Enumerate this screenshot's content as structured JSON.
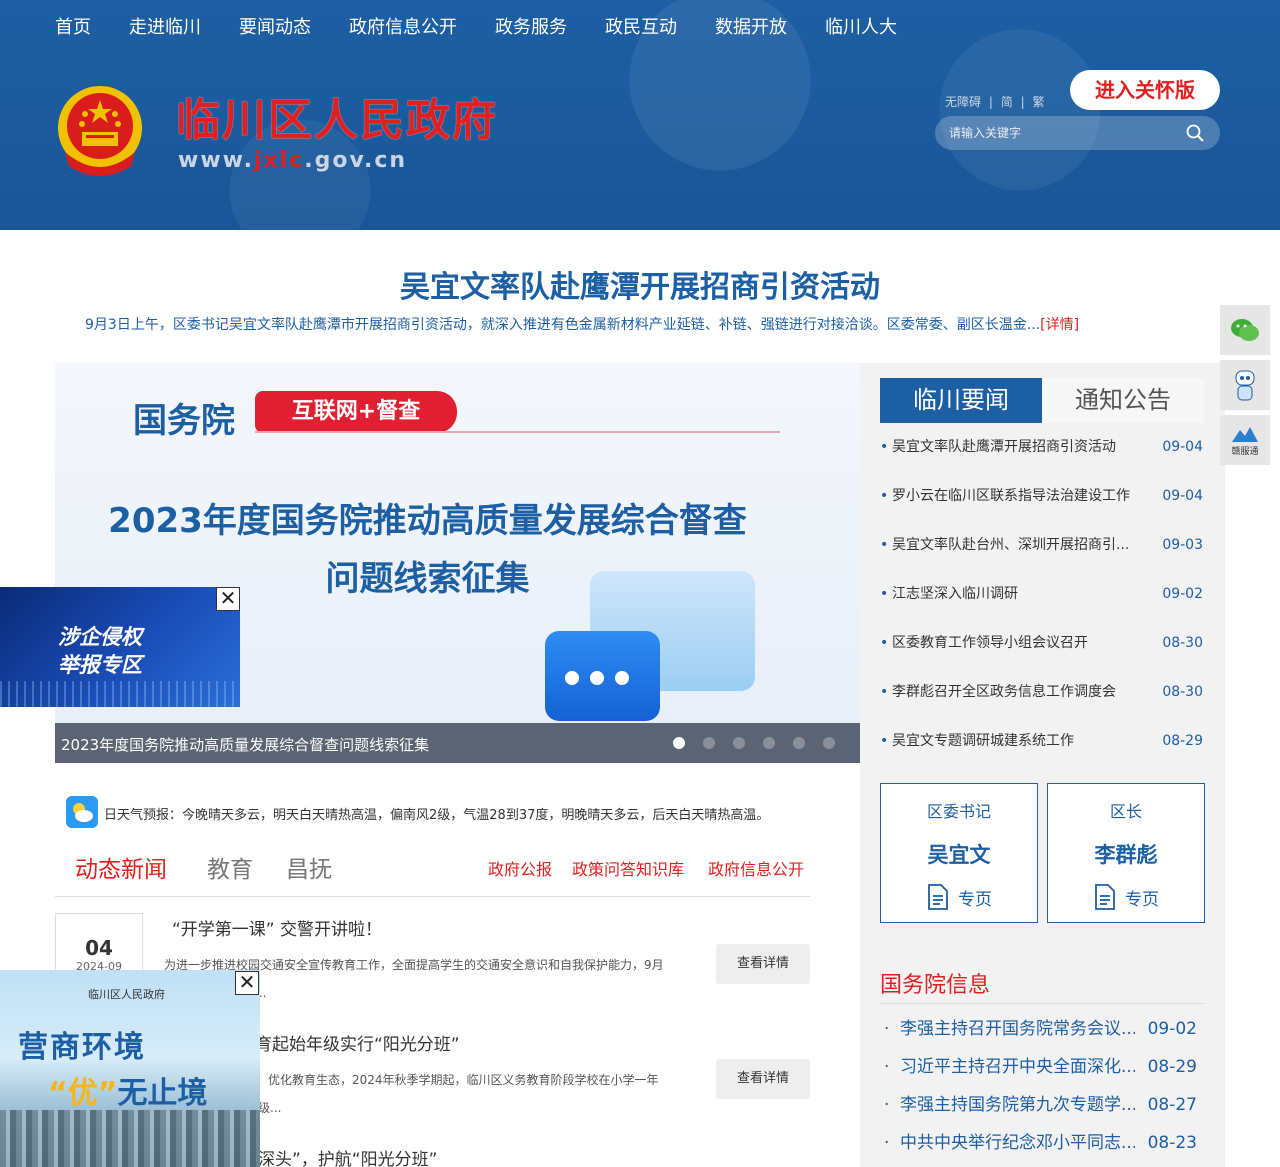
{
  "nav": [
    "首页",
    "走进临川",
    "要闻动态",
    "政府信息公开",
    "政务服务",
    "政民互动",
    "数据开放",
    "临川人大"
  ],
  "site": {
    "title": "临川区人民政府",
    "url_prefix": "www.",
    "url_highlight": "jxlc",
    "url_suffix": ".gov.cn"
  },
  "tools": {
    "accessible": "无障碍",
    "simplified": "简",
    "traditional": "繁",
    "sep": "|"
  },
  "care_mode": "进入关怀版",
  "search": {
    "placeholder": "请输入关键字"
  },
  "headline": {
    "title": "吴宜文率队赴鹰潭开展招商引资活动",
    "summary": "9月3日上午，区委书记吴宜文率队赴鹰潭市开展招商引资活动，就深入推进有色金属新材料产业延链、补链、强链进行对接洽谈。区委常委、副区长温金...",
    "more": "[详情]"
  },
  "carousel": {
    "logo": "国务院",
    "tag": "互联网+督查",
    "title_line1": "2023年度国务院推动高质量发展综合督查",
    "title_line2": "问题线索征集",
    "caption": "2023年度国务院推动高质量发展综合督查问题线索征集",
    "slide_count": 6,
    "active_slide": 1
  },
  "tabs": {
    "active": "临川要闻",
    "inactive": "通知公告"
  },
  "news": [
    {
      "title": "吴宜文率队赴鹰潭开展招商引资活动",
      "date": "09-04"
    },
    {
      "title": "罗小云在临川区联系指导法治建设工作",
      "date": "09-04"
    },
    {
      "title": "吴宜文率队赴台州、深圳开展招商引...",
      "date": "09-03"
    },
    {
      "title": "江志坚深入临川调研",
      "date": "09-02"
    },
    {
      "title": "区委教育工作领导小组会议召开",
      "date": "08-30"
    },
    {
      "title": "李群彪召开全区政务信息工作调度会",
      "date": "08-30"
    },
    {
      "title": "吴宜文专题调研城建系统工作",
      "date": "08-29"
    }
  ],
  "leaders": [
    {
      "role": "区委书记",
      "name": "吴宜文",
      "link": "专页"
    },
    {
      "role": "区长",
      "name": "李群彪",
      "link": "专页"
    }
  ],
  "state_council": {
    "title": "国务院信息",
    "items": [
      {
        "title": "李强主持召开国务院常务会议...",
        "date": "09-02"
      },
      {
        "title": "习近平主持召开中央全面深化...",
        "date": "08-29"
      },
      {
        "title": "李强主持国务院第九次专题学...",
        "date": "08-27"
      },
      {
        "title": "中共中央举行纪念邓小平同志...",
        "date": "08-23"
      }
    ]
  },
  "side_float": {
    "ganfutong": "赣服通"
  },
  "weather": "日天气预报：今晚晴天多云，明天白天晴热高温，偏南风2级，气温28到37度，明晚晴天多云，后天白天晴热高温。",
  "news_tabs": [
    "动态新闻",
    "教育",
    "昌抚"
  ],
  "quick_links": [
    "政府公报",
    "政策问答知识库",
    "政府信息公开"
  ],
  "articles": [
    {
      "day": "04",
      "ym": "2024-09",
      "title": "“开学第一课” 交警开讲啦！",
      "summary_l1": "为进一步推进校园交通安全宣传教育工作，全面提高学生的交通安全意识和自我保护能力，9月",
      "summary_l2": "...",
      "button": "查看详情"
    },
    {
      "title": "育起始年级实行“阳光分班”",
      "summary_l1": "优化教育生态，2024年秋季学期起，临川区义务教育阶段学校在小学一年",
      "summary_l2": "级...",
      "button": "查看详情"
    },
    {
      "title": "深头”，护航“阳光分班”"
    }
  ],
  "popup1": {
    "line1": "涉企侵权",
    "line2": "举报专区",
    "close": "✕"
  },
  "popup2": {
    "brand": "临川区人民政府",
    "line1": "营商环境",
    "line2_q": "“优”",
    "line2_rest": "无止境",
    "close": "✕"
  }
}
